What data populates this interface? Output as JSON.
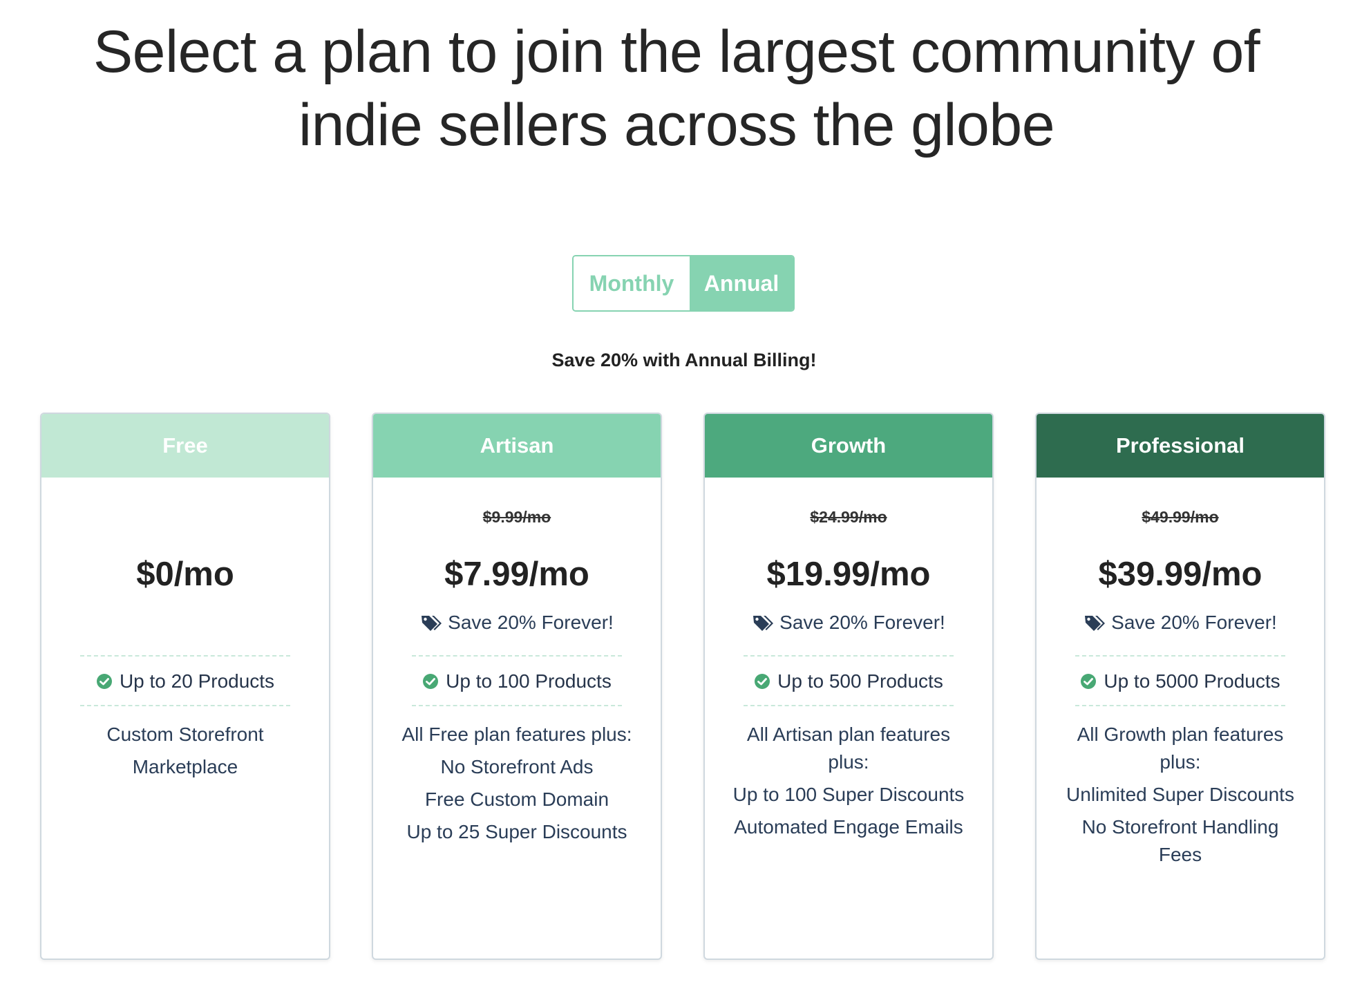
{
  "headline": {
    "line1": "Select a plan to join the largest community of",
    "line2": "indie sellers across the globe"
  },
  "billing_toggle": {
    "monthly_label": "Monthly",
    "annual_label": "Annual",
    "selected": "Annual"
  },
  "save_note": "Save 20% with Annual Billing!",
  "colors": {
    "accent": "#86d3b1",
    "free_header": "#c1e8d4",
    "artisan_header": "#86d3b1",
    "growth_header": "#4da97e",
    "professional_header": "#2e6c4f",
    "check_green": "#48a874",
    "text_navy": "#2a3d57"
  },
  "plans": [
    {
      "name": "Free",
      "old_price": "",
      "price": "$0/mo",
      "savings": "",
      "products": "Up to 20 Products",
      "features": [
        "Custom Storefront",
        "Marketplace"
      ]
    },
    {
      "name": "Artisan",
      "old_price": "$9.99/mo",
      "price": "$7.99/mo",
      "savings": "Save 20% Forever!",
      "products": "Up to 100 Products",
      "features": [
        "All Free plan features plus:",
        "No Storefront Ads",
        "Free Custom Domain",
        "Up to 25 Super Discounts"
      ]
    },
    {
      "name": "Growth",
      "old_price": "$24.99/mo",
      "price": "$19.99/mo",
      "savings": "Save 20% Forever!",
      "products": "Up to 500 Products",
      "features": [
        "All Artisan plan features plus:",
        "Up to 100 Super Discounts",
        "Automated Engage Emails"
      ]
    },
    {
      "name": "Professional",
      "old_price": "$49.99/mo",
      "price": "$39.99/mo",
      "savings": "Save 20% Forever!",
      "products": "Up to 5000 Products",
      "features": [
        "All Growth plan features plus:",
        "Unlimited Super Discounts",
        "No Storefront Handling Fees"
      ]
    }
  ],
  "icons": {
    "products_icon": "check-circle-icon",
    "savings_icon": "tags-icon"
  }
}
